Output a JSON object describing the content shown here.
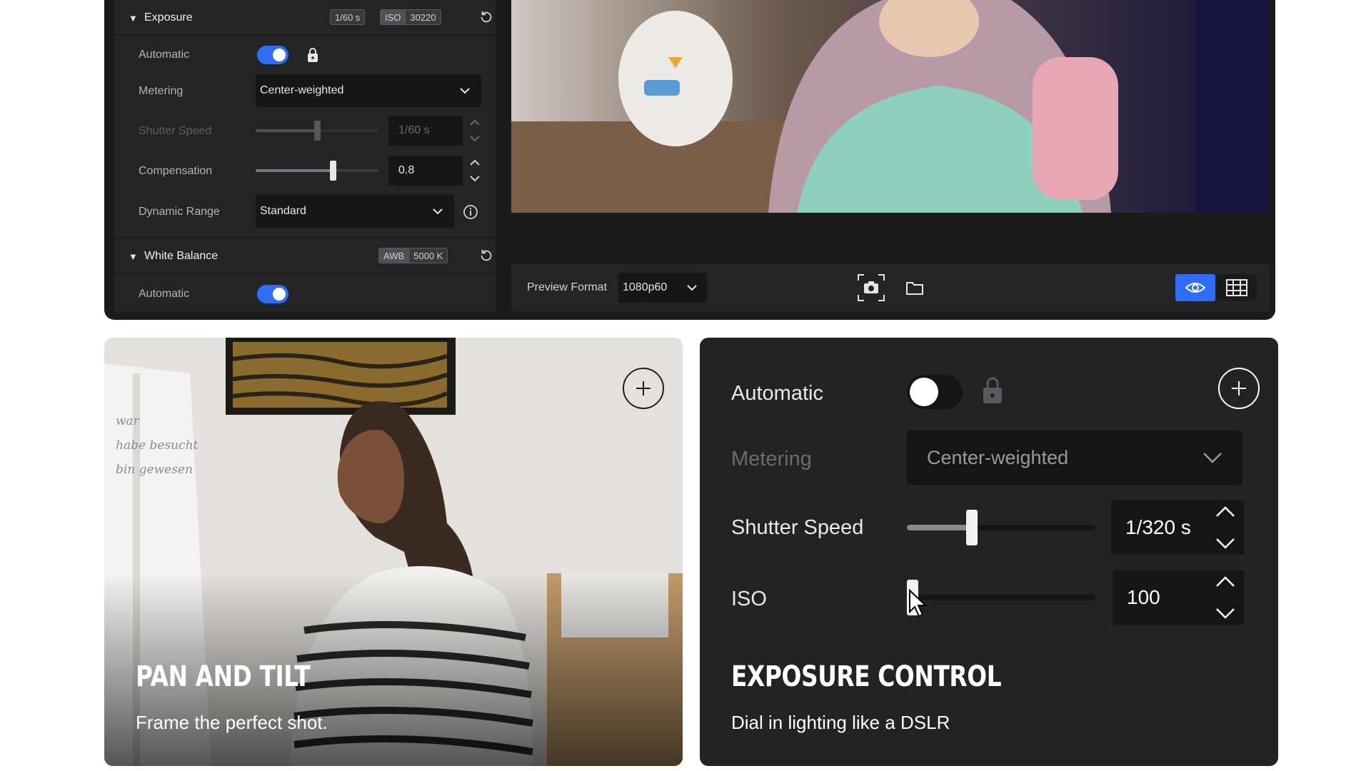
{
  "exposure_panel": {
    "title": "Exposure",
    "shutter_badge": "1/60 s",
    "iso_badge_label": "ISO",
    "iso_badge_value": "30220",
    "automatic_label": "Automatic",
    "automatic_on": true,
    "metering_label": "Metering",
    "metering_value": "Center-weighted",
    "shutter_label": "Shutter Speed",
    "shutter_value": "1/60 s",
    "compensation_label": "Compensation",
    "compensation_value": "0.8",
    "dynamic_range_label": "Dynamic Range",
    "dynamic_range_value": "Standard"
  },
  "white_balance_panel": {
    "title": "White Balance",
    "awb_badge_label": "AWB",
    "awb_badge_value": "5000 K",
    "automatic_label": "Automatic",
    "automatic_on": true
  },
  "preview_toolbar": {
    "format_label": "Preview Format",
    "format_value": "1080p60"
  },
  "cards": {
    "pan_tilt": {
      "title": "PAN AND TILT",
      "subtitle": "Frame the perfect shot.",
      "whiteboard_text": [
        "war",
        "habe besucht",
        "bin gewesen"
      ]
    },
    "exposure": {
      "title": "EXPOSURE CONTROL",
      "subtitle": "Dial in lighting like a DSLR",
      "automatic_label": "Automatic",
      "automatic_on": false,
      "metering_label": "Metering",
      "metering_value": "Center-weighted",
      "shutter_label": "Shutter Speed",
      "shutter_value": "1/320 s",
      "iso_label": "ISO",
      "iso_value": "100"
    }
  },
  "colors": {
    "accent": "#2f6df6",
    "panel_bg": "#242427",
    "window_bg": "#1b1b1d",
    "card_dark": "#232325"
  }
}
